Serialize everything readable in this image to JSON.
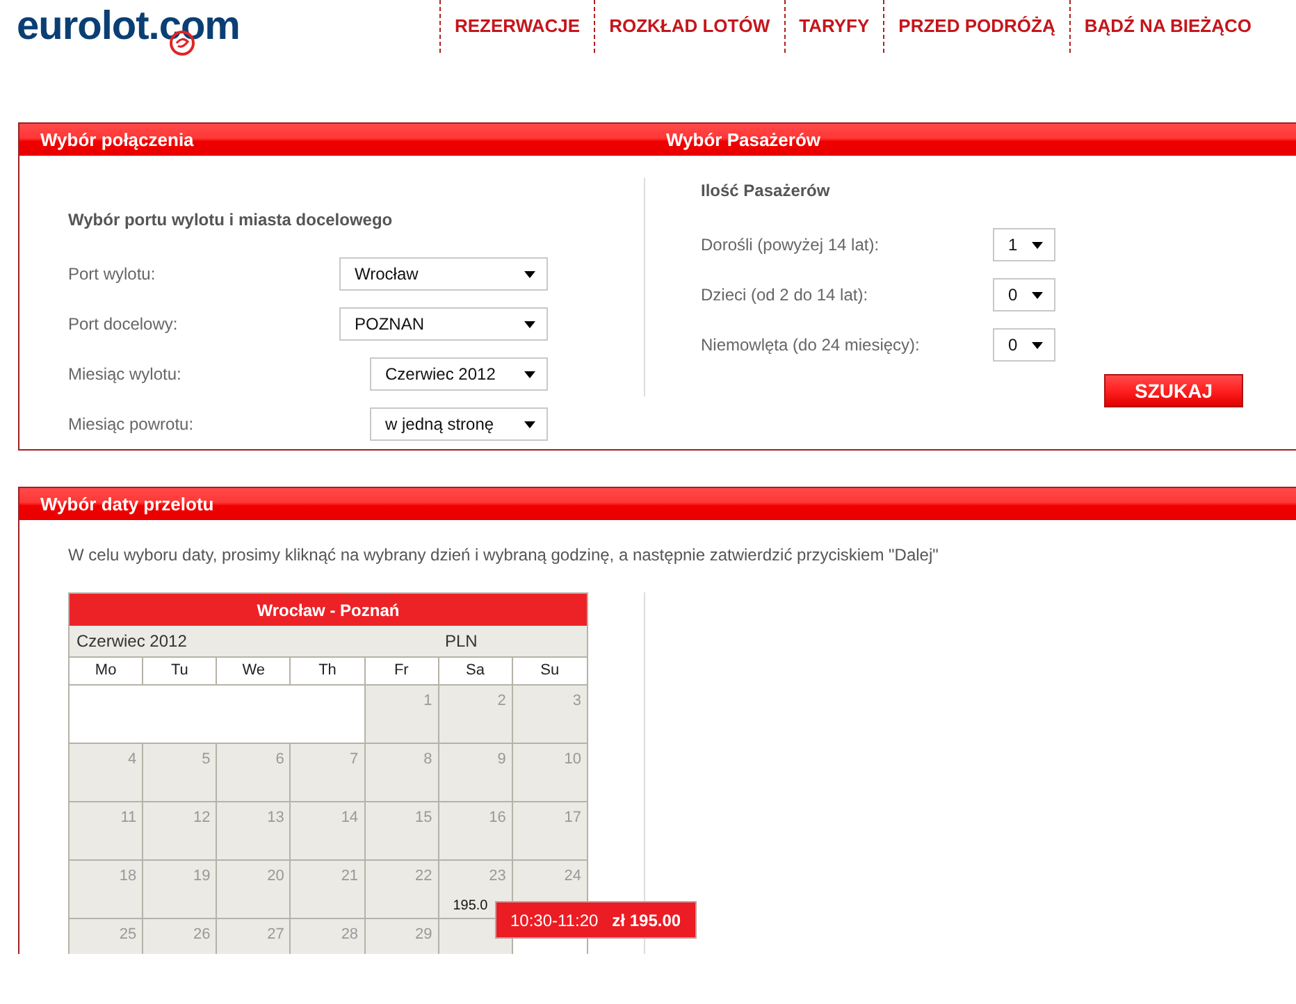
{
  "logo": "eurolot.com",
  "nav": [
    {
      "label": "REZERWACJE"
    },
    {
      "label": "ROZKŁAD LOTÓW"
    },
    {
      "label": "TARYFY"
    },
    {
      "label": "PRZED PODRÓŻĄ"
    },
    {
      "label": "BĄDŹ NA BIEŻĄCO"
    }
  ],
  "connection": {
    "title": "Wybór połączenia",
    "subtitle": "Wybór portu wylotu i miasta docelowego",
    "fields": [
      {
        "label": "Port wylotu:",
        "value": "Wrocław",
        "kind": "wide"
      },
      {
        "label": "Port docelowy:",
        "value": "POZNAN",
        "kind": "wide"
      },
      {
        "label": "Miesiąc wylotu:",
        "value": "Czerwiec 2012",
        "kind": "narrow"
      },
      {
        "label": "Miesiąc powrotu:",
        "value": "w jedną stronę",
        "kind": "narrow"
      }
    ]
  },
  "passengers": {
    "title": "Wybór Pasażerów",
    "subtitle": "Ilość Pasażerów",
    "fields": [
      {
        "label": "Dorośli (powyżej 14 lat):",
        "value": "1"
      },
      {
        "label": "Dzieci (od 2 do 14 lat):",
        "value": "0"
      },
      {
        "label": "Niemowlęta (do 24 miesięcy):",
        "value": "0"
      }
    ],
    "search_button": "SZUKAJ"
  },
  "date_selection": {
    "title": "Wybór daty przelotu",
    "instruction": "W celu wyboru daty, prosimy kliknąć na wybrany dzień i wybraną godzinę, a następnie zatwierdzić przyciskiem \"Dalej\"",
    "calendar": {
      "title": "Wrocław - Poznań",
      "month": "Czerwiec 2012",
      "currency": "PLN",
      "weekdays": [
        "Mo",
        "Tu",
        "We",
        "Th",
        "Fr",
        "Sa",
        "Su"
      ],
      "weeks": [
        [
          {
            "kind": "blank"
          },
          {
            "kind": "blank"
          },
          {
            "kind": "blank"
          },
          {
            "kind": "blank"
          },
          {
            "kind": "day",
            "day": "1"
          },
          {
            "kind": "day",
            "day": "2"
          },
          {
            "kind": "day",
            "day": "3"
          }
        ],
        [
          {
            "kind": "day",
            "day": "4"
          },
          {
            "kind": "day",
            "day": "5"
          },
          {
            "kind": "day",
            "day": "6"
          },
          {
            "kind": "day",
            "day": "7"
          },
          {
            "kind": "day",
            "day": "8"
          },
          {
            "kind": "day",
            "day": "9"
          },
          {
            "kind": "day",
            "day": "10"
          }
        ],
        [
          {
            "kind": "day",
            "day": "11"
          },
          {
            "kind": "day",
            "day": "12"
          },
          {
            "kind": "day",
            "day": "13"
          },
          {
            "kind": "day",
            "day": "14"
          },
          {
            "kind": "day",
            "day": "15"
          },
          {
            "kind": "day",
            "day": "16"
          },
          {
            "kind": "day",
            "day": "17"
          }
        ],
        [
          {
            "kind": "day",
            "day": "18"
          },
          {
            "kind": "day",
            "day": "19"
          },
          {
            "kind": "day",
            "day": "20"
          },
          {
            "kind": "day",
            "day": "21"
          },
          {
            "kind": "day",
            "day": "22"
          },
          {
            "kind": "day",
            "day": "23",
            "price": "195.0"
          },
          {
            "kind": "day",
            "day": "24"
          }
        ],
        [
          {
            "kind": "day",
            "day": "25"
          },
          {
            "kind": "day",
            "day": "26"
          },
          {
            "kind": "day",
            "day": "27"
          },
          {
            "kind": "day",
            "day": "28"
          },
          {
            "kind": "day",
            "day": "29"
          },
          {
            "kind": "day"
          }
        ]
      ],
      "tooltip": {
        "time": "10:30-11:20",
        "price": "zł 195.00"
      }
    }
  }
}
